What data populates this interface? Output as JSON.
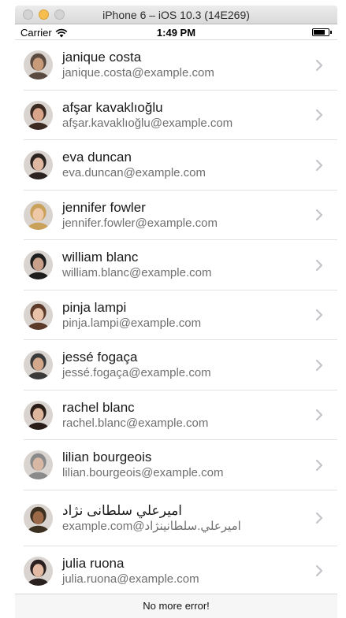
{
  "window": {
    "title": "iPhone 6 – iOS 10.3 (14E269)"
  },
  "statusbar": {
    "carrier": "Carrier",
    "time": "1:49 PM",
    "battery_level": 0.75
  },
  "users": [
    {
      "name": "janique costa",
      "email": "janique.costa@example.com",
      "avatar_color": "#5a4a3f",
      "skin": "#c79a7a"
    },
    {
      "name": "afşar kavaklıoğlu",
      "email": "afşar.kavaklıoğlu@example.com",
      "avatar_color": "#3b2a22",
      "skin": "#d9a58a"
    },
    {
      "name": "eva duncan",
      "email": "eva.duncan@example.com",
      "avatar_color": "#2b2320",
      "skin": "#e0b7a0"
    },
    {
      "name": "jennifer fowler",
      "email": "jennifer.fowler@example.com",
      "avatar_color": "#c9a15a",
      "skin": "#efc8a8"
    },
    {
      "name": "william blanc",
      "email": "william.blanc@example.com",
      "avatar_color": "#1e1e1e",
      "skin": "#c8a08a"
    },
    {
      "name": "pinja lampi",
      "email": "pinja.lampi@example.com",
      "avatar_color": "#5b3a2a",
      "skin": "#e8c2a8"
    },
    {
      "name": "jessé fogaça",
      "email": "jessé.fogaça@example.com",
      "avatar_color": "#3a3a3a",
      "skin": "#d3a88a"
    },
    {
      "name": "rachel blanc",
      "email": "rachel.blanc@example.com",
      "avatar_color": "#2a1d18",
      "skin": "#dcb59c"
    },
    {
      "name": "lilian bourgeois",
      "email": "lilian.bourgeois@example.com",
      "avatar_color": "#8a8a8a",
      "skin": "#d8b8a4"
    },
    {
      "name": "اميرعلي سلطانی نژاد",
      "email": "example.com@اميرعلي.سلطانینژاد",
      "avatar_color": "#3c3020",
      "skin": "#9c6a48"
    },
    {
      "name": "julia ruona",
      "email": "julia.ruona@example.com",
      "avatar_color": "#2a2020",
      "skin": "#e2b9a2"
    }
  ],
  "footer": {
    "message": "No more error!"
  }
}
